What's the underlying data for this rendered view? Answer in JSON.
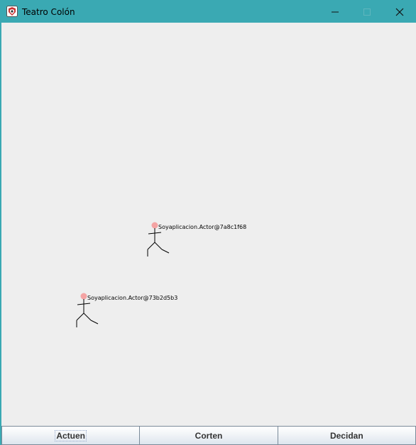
{
  "window": {
    "title": "Teatro Colón",
    "controls": {
      "minimize_icon": "minimize-icon",
      "maximize_icon": "maximize-icon",
      "close_icon": "close-icon"
    }
  },
  "stage": {
    "background": "#eeeeee",
    "actors": [
      {
        "label": "Soyaplicacion.Actor@7a8c1f68",
        "head_color": "#f4a3a3"
      },
      {
        "label": "Soyaplicacion.Actor@73b2d5b3",
        "head_color": "#f4a3a3"
      }
    ]
  },
  "buttons": {
    "actuen": "Actuen",
    "corten": "Corten",
    "decidan": "Decidan"
  },
  "colors": {
    "titlebar": "#3aa9b3",
    "panel": "#eeeeee"
  }
}
